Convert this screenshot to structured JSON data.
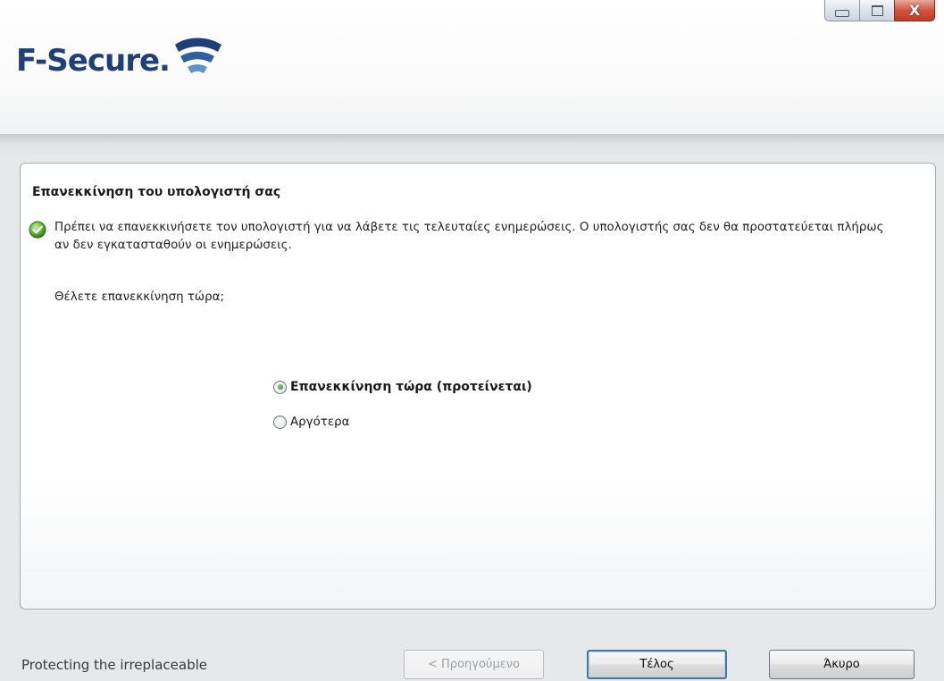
{
  "header": {
    "logo_text": "F-Secure.",
    "brand_color": "#1f3f7a"
  },
  "window_controls": {
    "minimize": "minimize-icon",
    "maximize": "maximize-icon",
    "close": "close-icon",
    "close_glyph": "X"
  },
  "panel": {
    "title": "Επανεκκίνηση του υπολογιστή σας",
    "message": "Πρέπει να επανεκκινήσετε τον υπολογιστή για να λάβετε τις τελευταίες ενημερώσεις. Ο υπολογιστής σας δεν θα προστατεύεται πλήρως αν δεν εγκατασταθούν οι ενημερώσεις.",
    "question": "Θέλετε επανεκκίνηση τώρα;",
    "options": [
      {
        "label": "Επανεκκίνηση τώρα (προτείνεται)",
        "selected": true
      },
      {
        "label": "Αργότερα",
        "selected": false
      }
    ]
  },
  "footer": {
    "tagline": "Protecting the irreplaceable",
    "back_label": "< Προηγούμενο",
    "finish_label": "Τέλος",
    "cancel_label": "Άκυρο"
  }
}
